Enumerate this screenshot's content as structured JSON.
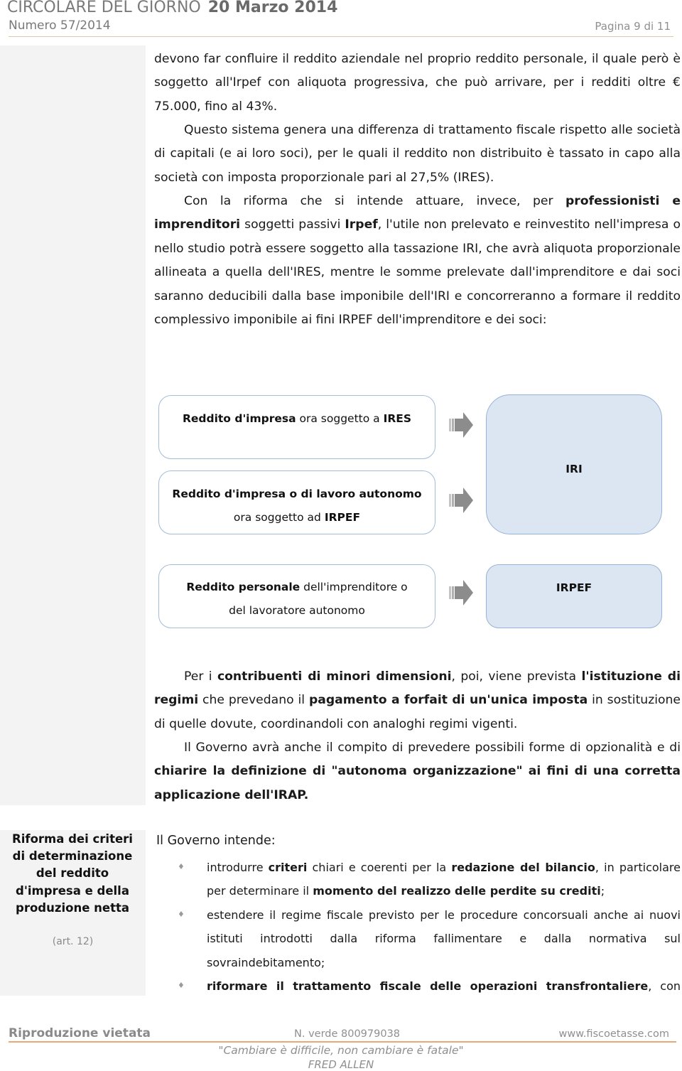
{
  "header": {
    "title": "CIRCOLARE DEL GIORNO",
    "date": "20 Marzo 2014",
    "number": "Numero  57/2014",
    "page": "Pagina 9 di 11"
  },
  "paragraphs": {
    "p1": "devono far confluire il reddito aziendale nel proprio reddito personale, il quale però è soggetto all'Irpef con aliquota progressiva, che può arrivare, per i redditi oltre € 75.000, fino al 43%.",
    "p2": "Questo sistema genera una differenza di trattamento fiscale rispetto alle società di capitali (e ai loro soci), per le quali il reddito non distribuito è tassato in capo alla società con imposta proporzionale pari al 27,5% (IRES).",
    "p3": {
      "a": "Con la riforma che si intende attuare, invece, per ",
      "b": "professionisti e imprenditori",
      "c": " soggetti passivi ",
      "d": "Irpef",
      "e": ", l'utile non prelevato e reinvestito nell'impresa o nello studio potrà essere soggetto alla tassazione IRI, che avrà aliquota proporzionale allineata a quella dell'IRES, mentre le somme prelevate dall'imprenditore e dai soci saranno deducibili dalla base imponibile dell'IRI e concorreranno a formare il reddito complessivo imponibile ai fini IRPEF dell'imprenditore e dei soci:"
    },
    "p4": {
      "a": "Per i ",
      "b": "contribuenti di minori dimensioni",
      "c": ", poi, viene prevista ",
      "d": "l'istituzione di regimi",
      "e": " che prevedano il ",
      "f": "pagamento a forfait di un'unica imposta",
      "g": " in sostituzione di quelle dovute, coordinandoli con analoghi regimi vigenti."
    },
    "p5": {
      "a": "Il Governo avrà anche il compito di prevedere possibili forme di opzionalità e di ",
      "b": "chiarire la definizione di \"autonoma organizzazione\" ai fini di una corretta applicazione dell'IRAP."
    }
  },
  "diagram": {
    "box1": {
      "bold1": "Reddito d'impresa",
      "text1": " ora soggetto a ",
      "bold2": "IRES"
    },
    "box2": {
      "line1": "Reddito d'impresa o di lavoro autonomo",
      "text2": "ora soggetto ad ",
      "bold2": "IRPEF"
    },
    "box3": {
      "bold1": "Reddito personale",
      "text1": " dell'imprenditore o",
      "line2": "del lavoratore autonomo"
    },
    "target1": "IRI",
    "target2": "IRPEF",
    "arrow_color": "#8c8c8c"
  },
  "sidebar": {
    "section_title": "Riforma dei criteri di determinazione del reddito d'impresa e della produzione netta",
    "article": "(art. 12)"
  },
  "list": {
    "intro": "Il Governo intende:",
    "bullet_glyph": "♦",
    "items": [
      {
        "t1": "introdurre ",
        "b1": "criteri",
        "t2": " chiari e coerenti per la ",
        "b2": "redazione del bilancio",
        "t3": ", in particolare per determinare il ",
        "b3": "momento del realizzo delle perdite su crediti",
        "t4": ";"
      },
      {
        "t1": "estendere il regime fiscale previsto per le procedure concorsuali anche ai nuovi istituti introdotti dalla riforma fallimentare e dalla normativa sul sovraindebitamento;"
      },
      {
        "b1": "riformare il trattamento fiscale delle operazioni transfrontaliere",
        "t1": ", con"
      }
    ]
  },
  "footer": {
    "left": "Riproduzione vietata",
    "phone": "N. verde 800979038",
    "website": "www.fiscoetasse.com",
    "quote": "\"Cambiare è difficile, non cambiare è fatale\"",
    "author": "FRED ALLEN"
  }
}
